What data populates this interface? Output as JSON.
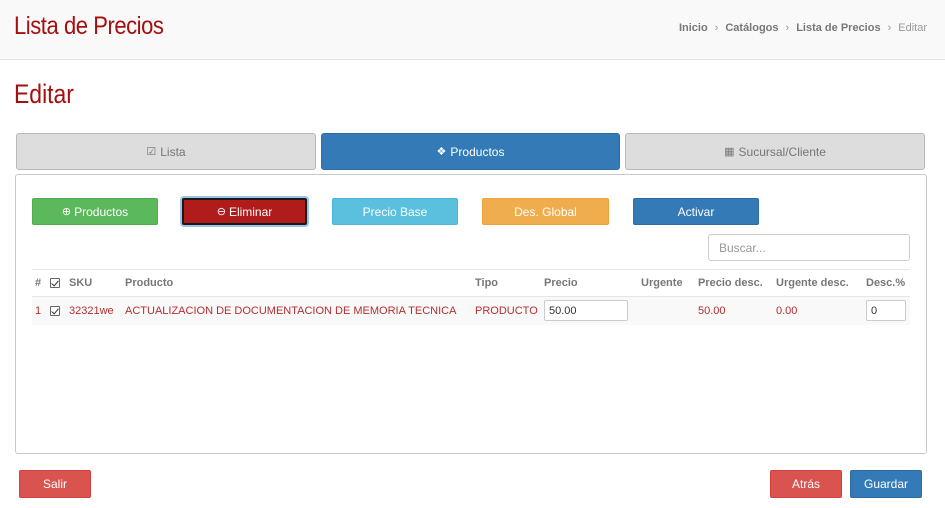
{
  "header": {
    "title": "Lista de Precios",
    "breadcrumb": [
      {
        "label": "Inicio"
      },
      {
        "label": "Catálogos"
      },
      {
        "label": "Lista de Precios"
      },
      {
        "label": "Editar"
      }
    ]
  },
  "page_title": "Editar",
  "tabs": [
    {
      "label": "Lista",
      "icon": "check-square-icon",
      "active": false
    },
    {
      "label": "Productos",
      "icon": "cubes-icon",
      "active": true
    },
    {
      "label": "Sucursal/Cliente",
      "icon": "building-icon",
      "active": false
    }
  ],
  "toolbar": {
    "add_products_label": "Productos",
    "delete_label": "Eliminar",
    "base_price_label": "Precio Base",
    "global_discount_label": "Des. Global",
    "activate_label": "Activar"
  },
  "search": {
    "placeholder": "Buscar...",
    "value": ""
  },
  "table": {
    "columns": [
      "#",
      "",
      "SKU",
      "Producto",
      "Tipo",
      "Precio",
      "Urgente",
      "Precio desc.",
      "Urgente desc.",
      "Desc.%"
    ],
    "rows": [
      {
        "index": "1",
        "checked": true,
        "sku": "32321we",
        "product": "ACTUALIZACION DE DOCUMENTACION DE MEMORIA TECNICA",
        "type": "PRODUCTO",
        "price": "50.00",
        "urgent": "",
        "discount_price": "50.00",
        "urgent_discount": "0.00",
        "discount_pct": "0"
      }
    ]
  },
  "footer": {
    "exit_label": "Salir",
    "back_label": "Atrás",
    "save_label": "Guardar"
  },
  "colors": {
    "brand_red": "#a50f0f",
    "primary": "#337ab7",
    "success": "#5cb85c",
    "info": "#5bc0de",
    "warning": "#f0ad4e",
    "danger": "#d9534f"
  }
}
